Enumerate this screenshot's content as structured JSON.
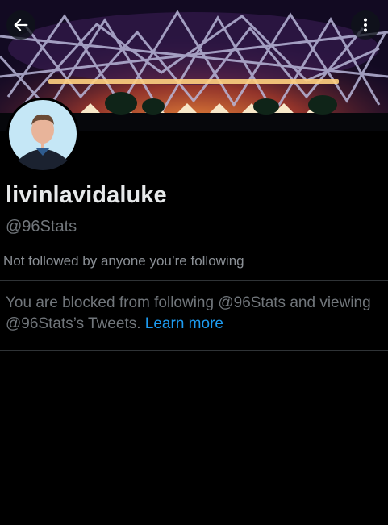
{
  "header": {
    "back_icon": "arrow-left-icon",
    "more_icon": "more-vertical-icon"
  },
  "profile": {
    "display_name": "livinlavidaluke",
    "handle": "@96Stats",
    "follow_note": "Not followed by anyone you’re following"
  },
  "blocked_notice": {
    "text": "You are blocked from following @96Stats and viewing @96Stats’s Tweets.",
    "link_label": "Learn more"
  },
  "colors": {
    "background": "#000000",
    "primary_text": "#e7e9ea",
    "secondary_text": "#71767b",
    "link": "#1d9bf0",
    "divider": "#2f3336"
  }
}
